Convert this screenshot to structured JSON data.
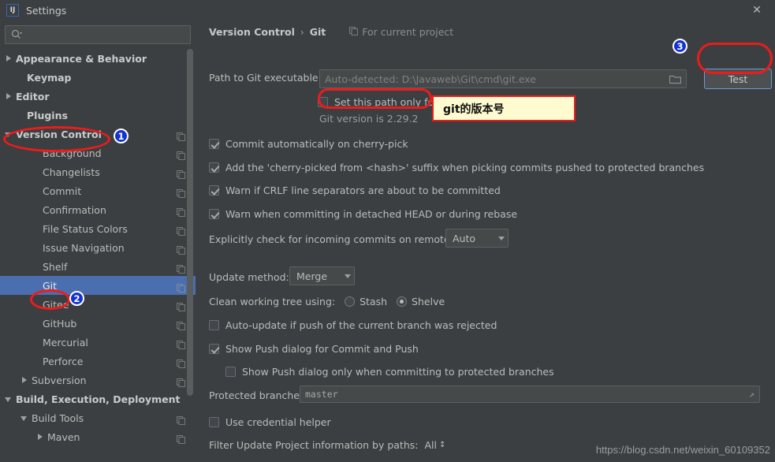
{
  "window": {
    "title": "Settings",
    "logo": "intellij-idea-logo",
    "close_label": "✕"
  },
  "sidebar": {
    "search": {
      "placeholder": "",
      "value": "",
      "icon": "search-icon"
    },
    "items": [
      {
        "label": "Appearance & Behavior",
        "indent": 6,
        "arrow": "right",
        "bold": true,
        "copy": false,
        "selected": false
      },
      {
        "label": "Keymap",
        "indent": 20,
        "arrow": "none",
        "bold": true,
        "copy": false,
        "selected": false
      },
      {
        "label": "Editor",
        "indent": 6,
        "arrow": "right",
        "bold": true,
        "copy": false,
        "selected": false
      },
      {
        "label": "Plugins",
        "indent": 20,
        "arrow": "none",
        "bold": true,
        "copy": false,
        "selected": false
      },
      {
        "label": "Version Control",
        "indent": 6,
        "arrow": "down",
        "bold": true,
        "copy": true,
        "selected": false
      },
      {
        "label": "Background",
        "indent": 40,
        "arrow": "none",
        "bold": false,
        "copy": true,
        "selected": false
      },
      {
        "label": "Changelists",
        "indent": 40,
        "arrow": "none",
        "bold": false,
        "copy": true,
        "selected": false
      },
      {
        "label": "Commit",
        "indent": 40,
        "arrow": "none",
        "bold": false,
        "copy": true,
        "selected": false
      },
      {
        "label": "Confirmation",
        "indent": 40,
        "arrow": "none",
        "bold": false,
        "copy": true,
        "selected": false
      },
      {
        "label": "File Status Colors",
        "indent": 40,
        "arrow": "none",
        "bold": false,
        "copy": true,
        "selected": false
      },
      {
        "label": "Issue Navigation",
        "indent": 40,
        "arrow": "none",
        "bold": false,
        "copy": true,
        "selected": false
      },
      {
        "label": "Shelf",
        "indent": 40,
        "arrow": "none",
        "bold": false,
        "copy": true,
        "selected": false
      },
      {
        "label": "Git",
        "indent": 40,
        "arrow": "none",
        "bold": false,
        "copy": true,
        "selected": true
      },
      {
        "label": "Gitee",
        "indent": 40,
        "arrow": "none",
        "bold": false,
        "copy": true,
        "selected": false
      },
      {
        "label": "GitHub",
        "indent": 40,
        "arrow": "none",
        "bold": false,
        "copy": true,
        "selected": false
      },
      {
        "label": "Mercurial",
        "indent": 40,
        "arrow": "none",
        "bold": false,
        "copy": true,
        "selected": false
      },
      {
        "label": "Perforce",
        "indent": 40,
        "arrow": "none",
        "bold": false,
        "copy": true,
        "selected": false
      },
      {
        "label": "Subversion",
        "indent": 26,
        "arrow": "right",
        "bold": false,
        "copy": true,
        "selected": false
      },
      {
        "label": "Build, Execution, Deployment",
        "indent": 6,
        "arrow": "down",
        "bold": true,
        "copy": false,
        "selected": false
      },
      {
        "label": "Build Tools",
        "indent": 26,
        "arrow": "down",
        "bold": false,
        "copy": true,
        "selected": false
      },
      {
        "label": "Maven",
        "indent": 46,
        "arrow": "right",
        "bold": false,
        "copy": true,
        "selected": false
      }
    ]
  },
  "main": {
    "breadcrumb": {
      "parent": "Version Control",
      "separator": "›",
      "current": "Git"
    },
    "for_current_project": {
      "label": "For current project",
      "icon": "copy-icon"
    },
    "git_path": {
      "label": "Path to Git executable:",
      "placeholder": "Auto-detected: D:\\Javaweb\\Git\\cmd\\git.exe",
      "value": "",
      "browse_icon": "folder-icon"
    },
    "test_button": {
      "label": "Test"
    },
    "path_only_checkbox": {
      "label": "Set this path only for the current project",
      "checked": false
    },
    "git_version_text": "Git version is 2.29.2",
    "checkboxes": [
      {
        "label": "Commit automatically on cherry-pick",
        "checked": true
      },
      {
        "label": "Add the 'cherry-picked from <hash>' suffix when picking commits pushed to protected branches",
        "checked": true
      },
      {
        "label": "Warn if CRLF line separators are about to be committed",
        "checked": true
      },
      {
        "label": "Warn when committing in detached HEAD or during rebase",
        "checked": true
      }
    ],
    "incoming_commits": {
      "label": "Explicitly check for incoming commits on remotes:",
      "value": "Auto"
    },
    "update_method": {
      "label": "Update method:",
      "value": "Merge"
    },
    "clean_working_tree": {
      "label": "Clean working tree using:",
      "options": [
        {
          "label": "Stash",
          "selected": false
        },
        {
          "label": "Shelve",
          "selected": true
        }
      ]
    },
    "auto_update_checkbox": {
      "label": "Auto-update if push of the current branch was rejected",
      "checked": false
    },
    "show_push_checkbox": {
      "label": "Show Push dialog for Commit and Push",
      "checked": true
    },
    "show_push_protected_checkbox": {
      "label": "Show Push dialog only when committing to protected branches",
      "checked": false
    },
    "protected_branches": {
      "label": "Protected branches:",
      "value": "master"
    },
    "credential_helper_checkbox": {
      "label": "Use credential helper",
      "checked": false
    },
    "filter_update": {
      "label": "Filter Update Project information by paths:",
      "value": "All"
    }
  },
  "watermark": "https://blog.csdn.net/weixin_60109352",
  "annotations": {
    "badge1": "1",
    "badge2": "2",
    "badge3": "3",
    "callout_text": "git的版本号",
    "highlight_color": "#ee1b1b",
    "badge_color": "#1433cc",
    "callout_bg": "#fdfbcf"
  }
}
